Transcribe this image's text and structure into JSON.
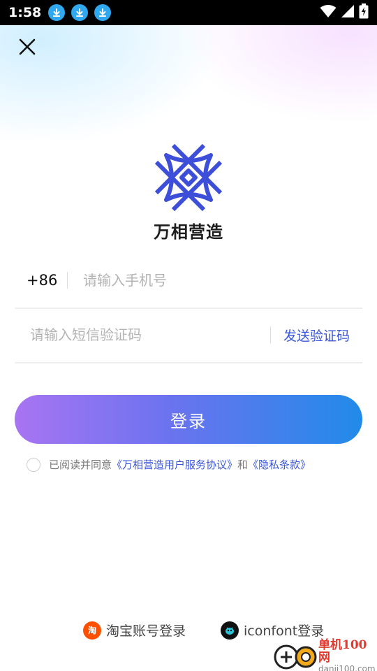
{
  "status_bar": {
    "time": "1:58",
    "icons": [
      "download-icon",
      "download-icon",
      "download-icon",
      "wifi-icon",
      "signal-icon",
      "battery-charging-icon"
    ]
  },
  "header": {
    "close_icon": "close-icon"
  },
  "brand": {
    "name": "万相营造",
    "accent_color": "#3d4fd8"
  },
  "phone_field": {
    "country_code": "+86",
    "placeholder": "请输入手机号",
    "value": ""
  },
  "code_field": {
    "placeholder": "请输入短信验证码",
    "value": "",
    "send_label": "发送验证码"
  },
  "login": {
    "label": "登录"
  },
  "agreement": {
    "checked": false,
    "prefix": "已阅读并同意",
    "terms_link": "《万相营造用户服务协议》",
    "connector": "和",
    "privacy_link": "《隐私条款》"
  },
  "third_party": {
    "taobao": {
      "icon_text": "淘",
      "label": "淘宝账号登录"
    },
    "iconfont": {
      "label": "iconfont登录"
    }
  },
  "watermark": {
    "name": "单机100网",
    "url": "danji100.com"
  }
}
